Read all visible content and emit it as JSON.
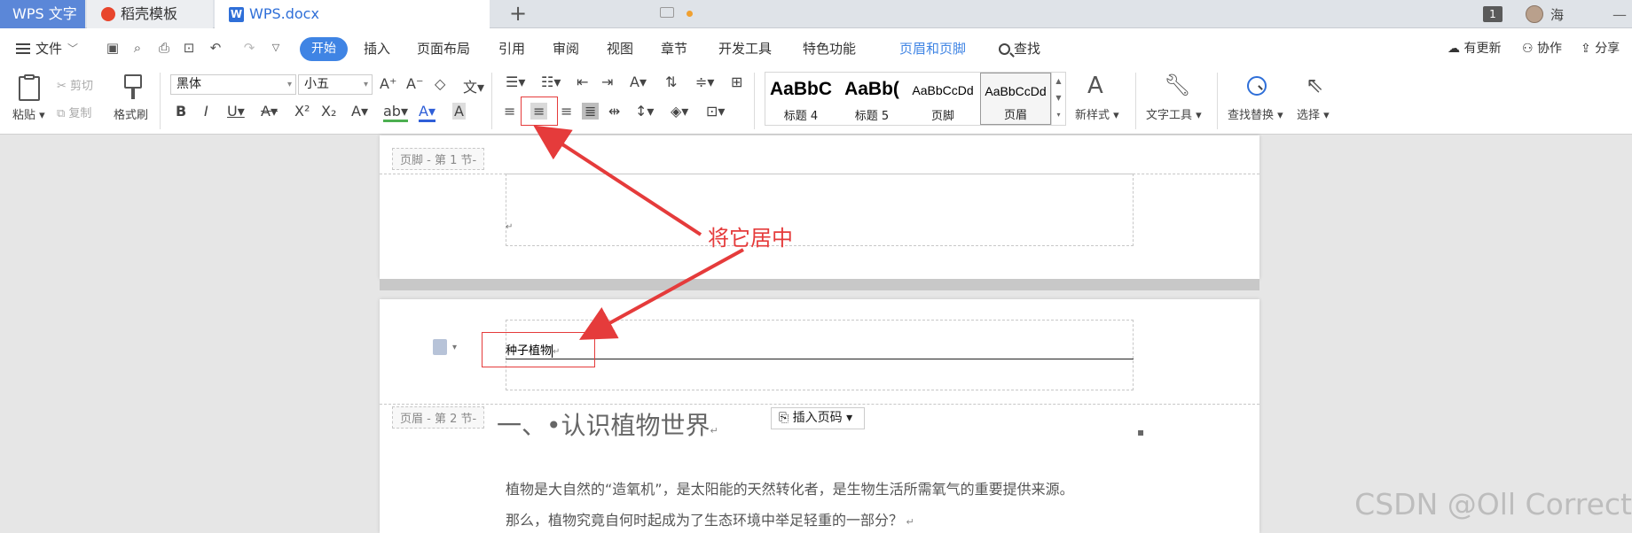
{
  "tabs": {
    "wps": "WPS 文字",
    "daoke": "稻壳模板",
    "doc": "WPS.docx",
    "page_count": "1",
    "user": "海"
  },
  "menu": {
    "file": "文件",
    "items": [
      "开始",
      "插入",
      "页面布局",
      "引用",
      "审阅",
      "视图",
      "章节",
      "开发工具",
      "特色功能",
      "页眉和页脚"
    ],
    "search": "查找",
    "right": [
      "有更新",
      "协作",
      "分享"
    ]
  },
  "ribbon": {
    "paste": "粘贴",
    "cut": "剪切",
    "copy": "复制",
    "format_painter": "格式刷",
    "font": "黑体",
    "size": "小五",
    "styles": [
      {
        "preview": "AaBbC",
        "label": "标题 4"
      },
      {
        "preview": "AaBb(",
        "label": "标题 5"
      },
      {
        "preview": "AaBbCcDd",
        "label": "页脚"
      },
      {
        "preview": "AaBbCcDd",
        "label": "页眉"
      }
    ],
    "new_style": "新样式",
    "text_tool": "文字工具",
    "find_replace": "查找替换",
    "select": "选择"
  },
  "document": {
    "footer_tag": "页脚 - 第 1 节-",
    "header_tag": "页眉 - 第 2 节-",
    "header_text": "种子植物",
    "insert_page_number": "插入页码",
    "heading": "一、•认识植物世界",
    "paragraph_1": "植物是大自然的“造氧机”，是太阳能的天然转化者，是生物生活所需氧气的重要提供来源。",
    "paragraph_2": "那么，植物究竟自何时起成为了生态环境中举足轻重的一部分？"
  },
  "annotation": "将它居中",
  "watermark": "CSDN @Oll Correct",
  "colors": {
    "accent": "#3f84e4",
    "annotation_red": "#e53b3b"
  }
}
